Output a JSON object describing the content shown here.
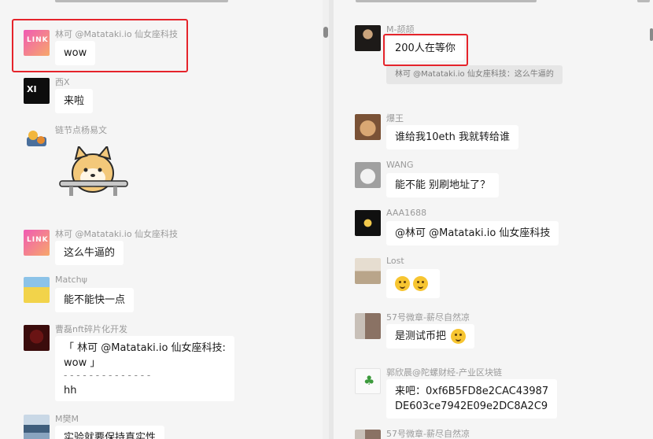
{
  "left_pane": {
    "messages": [
      {
        "sender": "林可 @Matataki.io 仙女座科技",
        "text": "wow",
        "avatar_icon": "link-avatar-icon",
        "avatar_text": "LINK",
        "highlighted": true
      },
      {
        "sender": "西X",
        "text": "来啦",
        "avatar_icon": "xi-avatar-icon",
        "avatar_text": "XI"
      },
      {
        "sender": "链节点杨易文",
        "sticker": "shiba-dog-sticker"
      },
      {
        "sender": "林可 @Matataki.io 仙女座科技",
        "text": "这么牛逼的",
        "avatar_icon": "link-avatar-icon",
        "avatar_text": "LINK"
      },
      {
        "sender": "Matchψ",
        "text": "能不能快一点",
        "avatar_icon": "spongebob-avatar-icon"
      },
      {
        "sender": "曹磊nft碎片化开发",
        "quote_line1": "「 林可 @Matataki.io 仙女座科技:",
        "quote_line2": "wow 」",
        "separator": "- - - - - - - - - - - - - -",
        "text": "hh",
        "avatar_icon": "red-avatar-icon"
      },
      {
        "sender": "M樊M",
        "text": "实验就要保持真实性",
        "avatar_icon": "landscape-avatar-icon"
      }
    ]
  },
  "right_pane": {
    "messages": [
      {
        "sender": "M-颉颉",
        "text": "200人在等你",
        "avatar_icon": "dark-portrait-avatar-icon",
        "highlighted": true,
        "quote": "林可 @Matataki.io 仙女座科技：这么牛逼的"
      },
      {
        "sender": "爆王",
        "text": "谁给我10eth 我就转给谁",
        "avatar_icon": "monkey-avatar-icon"
      },
      {
        "sender": "WANG",
        "text": "能不能 别刷地址了？",
        "avatar_icon": "cat-avatar-icon"
      },
      {
        "sender": "AAA1688",
        "text": "@林可 @Matataki.io 仙女座科技",
        "avatar_icon": "black-avatar-icon"
      },
      {
        "sender": "Lost",
        "text": "",
        "emoji_count": 2,
        "avatar_icon": "lost-avatar-icon"
      },
      {
        "sender": "57号微章-薪尽自然凉",
        "text": "是测试币把",
        "avatar_icon": "girl-avatar-icon",
        "trailing_emoji": true
      },
      {
        "sender": "郭欣晨@陀螺财经-产业区块链",
        "text_line1": "来吧：0xf6B5FD8e2CAC43987",
        "text_line2": "DE603ce7942E09e2DC8A2C9",
        "avatar_icon": "sprout-avatar-icon"
      },
      {
        "sender": "57号微章-薪尽自然凉",
        "avatar_icon": "girl-avatar-icon"
      }
    ]
  },
  "colors": {
    "highlight": "#e5242b",
    "bubble": "#ffffff",
    "background": "#f5f5f5"
  }
}
